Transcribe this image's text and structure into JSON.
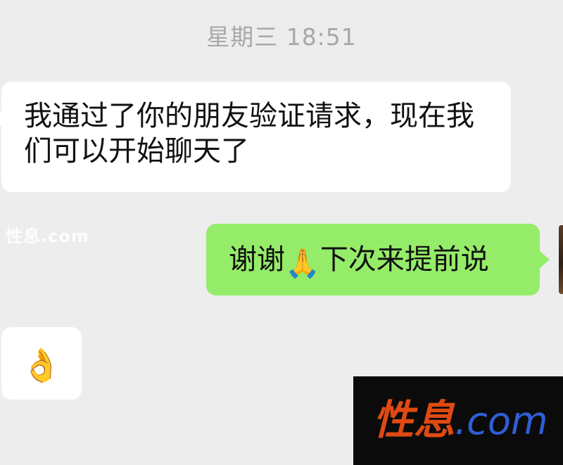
{
  "chat": {
    "timestamp": "星期三 18:51",
    "messages": [
      {
        "direction": "incoming",
        "text": "我通过了你的朋友验证请求，现在我们可以开始聊天了"
      },
      {
        "direction": "outgoing",
        "text_before_emoji": "谢谢",
        "emoji": "🙏",
        "emoji_name": "folded-hands",
        "text_after_emoji": "下次来提前说"
      },
      {
        "direction": "incoming",
        "emoji": "👌",
        "emoji_name": "ok-hand"
      }
    ]
  },
  "watermark": {
    "small": "性息.com",
    "brand_cn": "性息",
    "brand_domain": ".com"
  },
  "colors": {
    "background": "#ededed",
    "incoming_bubble": "#ffffff",
    "outgoing_bubble": "#95ec69",
    "timestamp_text": "#a8a8a8"
  }
}
